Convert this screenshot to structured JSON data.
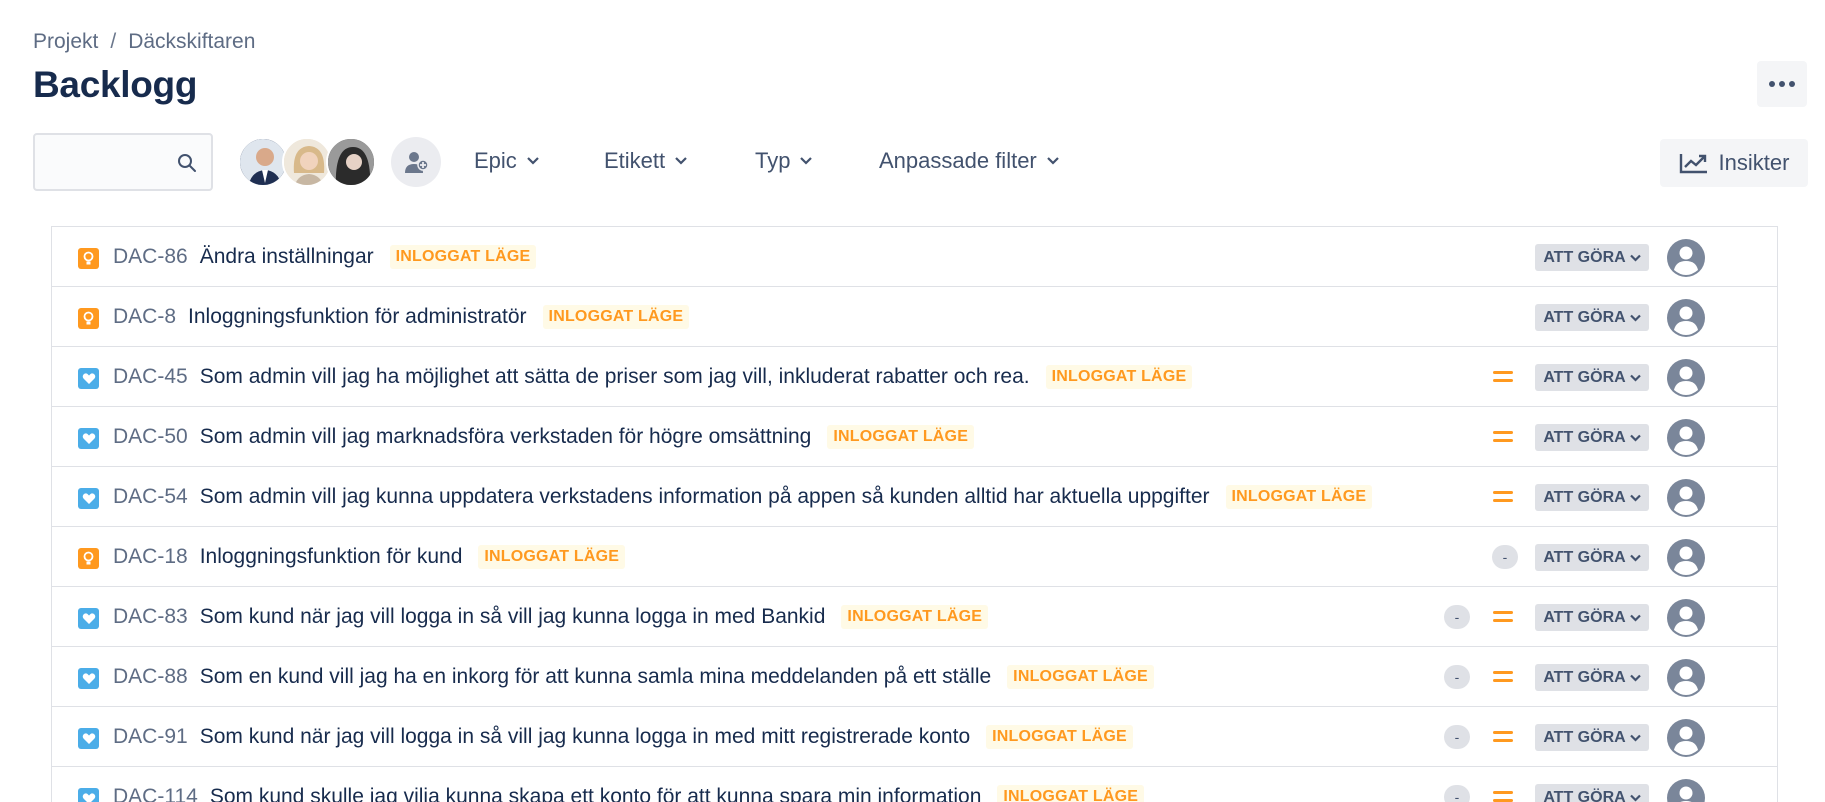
{
  "breadcrumb": {
    "project": "Projekt",
    "separator": "/",
    "current": "Däckskiftaren"
  },
  "page": {
    "title": "Backlogg"
  },
  "search": {
    "value": "",
    "placeholder": ""
  },
  "filters": {
    "epic": "Epic",
    "label": "Etikett",
    "type": "Typ",
    "custom": "Anpassade filter"
  },
  "insights": {
    "label": "Insikter"
  },
  "colors": {
    "epic": "#ff991f",
    "story": "#4bade8",
    "priority_medium": "#ff991f",
    "label_text": "#ff991f"
  },
  "issues": [
    {
      "type": "epic-icon",
      "key": "DAC-86",
      "summary": "Ändra inställningar",
      "label": "INLOGGAT LÄGE",
      "priority": false,
      "badges": 0,
      "status": "ATT GÖRA"
    },
    {
      "type": "epic-icon",
      "key": "DAC-8",
      "summary": "Inloggningsfunktion för administratör",
      "label": "INLOGGAT LÄGE",
      "priority": false,
      "badges": 0,
      "status": "ATT GÖRA"
    },
    {
      "type": "story-icon",
      "key": "DAC-45",
      "summary": "Som admin vill jag ha möjlighet att sätta de priser som jag vill, inkluderat rabatter och rea.",
      "label": "INLOGGAT LÄGE",
      "priority": true,
      "badges": 0,
      "status": "ATT GÖRA"
    },
    {
      "type": "story-icon",
      "key": "DAC-50",
      "summary": "Som admin vill jag marknadsföra verkstaden för högre omsättning",
      "label": "INLOGGAT LÄGE",
      "priority": true,
      "badges": 0,
      "status": "ATT GÖRA"
    },
    {
      "type": "story-icon",
      "key": "DAC-54",
      "summary": "Som admin vill jag kunna uppdatera verkstadens information på appen så kunden alltid har aktuella uppgifter",
      "label": "INLOGGAT LÄGE",
      "priority": true,
      "badges": 0,
      "status": "ATT GÖRA"
    },
    {
      "type": "epic-icon",
      "key": "DAC-18",
      "summary": "Inloggningsfunktion för kund",
      "label": "INLOGGAT LÄGE",
      "priority": false,
      "badges": 1,
      "status": "ATT GÖRA",
      "badge_text": "-"
    },
    {
      "type": "story-icon",
      "key": "DAC-83",
      "summary": "Som kund när jag vill logga in så vill jag kunna logga in med Bankid",
      "label": "INLOGGAT LÄGE",
      "priority": true,
      "badges": 1,
      "status": "ATT GÖRA",
      "badge_text": "-"
    },
    {
      "type": "story-icon",
      "key": "DAC-88",
      "summary": "Som en kund vill jag ha en inkorg för att kunna samla mina meddelanden på ett ställe",
      "label": "INLOGGAT LÄGE",
      "priority": true,
      "badges": 1,
      "status": "ATT GÖRA",
      "badge_text": "-"
    },
    {
      "type": "story-icon",
      "key": "DAC-91",
      "summary": "Som kund när jag vill logga in så vill jag kunna logga in med mitt registrerade konto",
      "label": "INLOGGAT LÄGE",
      "priority": true,
      "badges": 1,
      "status": "ATT GÖRA",
      "badge_text": "-"
    },
    {
      "type": "story-icon",
      "key": "DAC-114",
      "summary": "Som kund skulle jag vilja kunna skapa ett konto för att kunna spara min information",
      "label": "INLOGGAT LÄGE",
      "priority": true,
      "badges": 1,
      "status": "ATT GÖRA",
      "badge_text": "-"
    }
  ]
}
